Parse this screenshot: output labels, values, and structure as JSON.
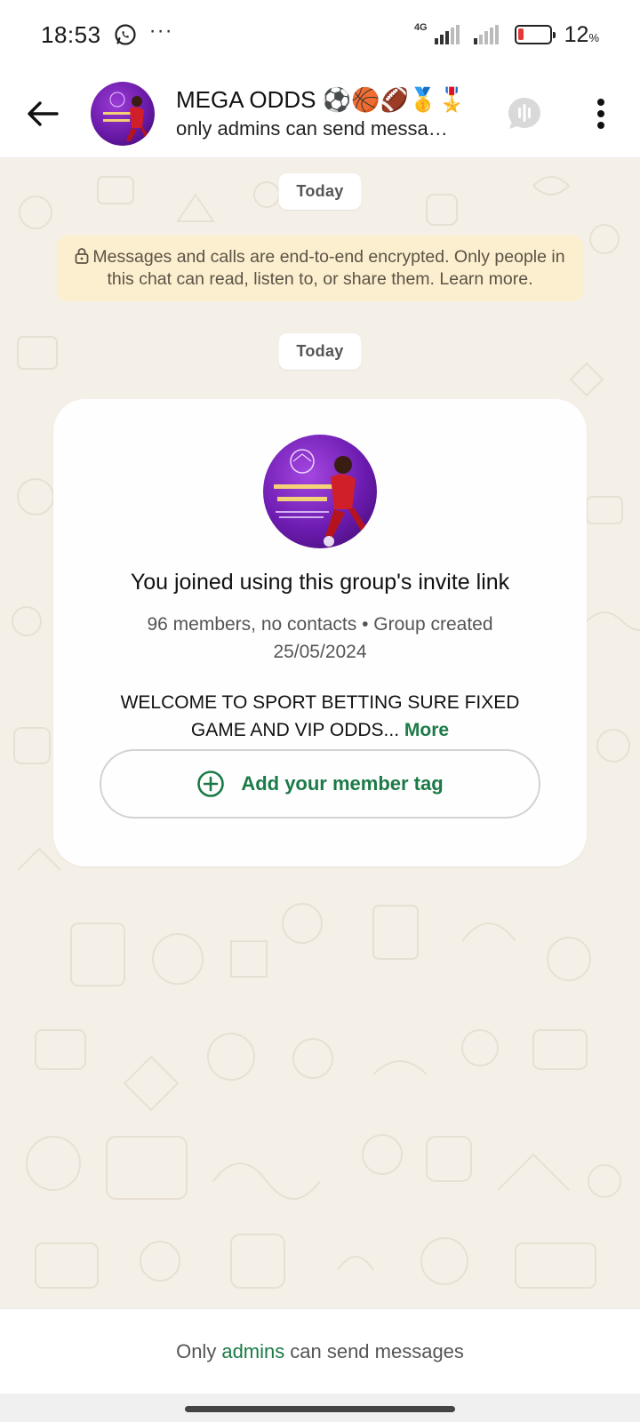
{
  "status_bar": {
    "time": "18:53",
    "dots": "···",
    "network": "4G",
    "battery_percent": "12",
    "battery_unit": "%"
  },
  "header": {
    "group_name": "MEGA ODDS ⚽🏀🏈🥇🎖️",
    "subtitle": "only admins can send messa…",
    "avatar_text_1": "PROGRAMMED GAMES",
    "avatar_text_2": "AVAILABLE NOW"
  },
  "chat": {
    "date_label_1": "Today",
    "encryption_notice": "Messages and calls are end-to-end encrypted. Only people in this chat can read, listen to, or share them. Learn more.",
    "date_label_2": "Today",
    "card": {
      "title": "You joined using this group's invite link",
      "meta_line_1": "96 members, no contacts • Group created",
      "meta_line_2": "25/05/2024",
      "description": "WELCOME TO SPORT BETTING SURE FIXED GAME AND VIP ODDS...",
      "more_label": "More",
      "member_tag_label": "Add your member tag",
      "avatar_text_1": "PROGRAMMED GAMES",
      "avatar_text_2": "AVAILABLE NOW"
    }
  },
  "footer": {
    "prefix": "Only",
    "link": "admins",
    "suffix": "can send messages"
  },
  "colors": {
    "accent_green": "#1b7a47",
    "encryption_bg": "#fcefcf",
    "wallpaper_bg": "#f4f0e8",
    "avatar_purple": "#6c1bb0"
  }
}
